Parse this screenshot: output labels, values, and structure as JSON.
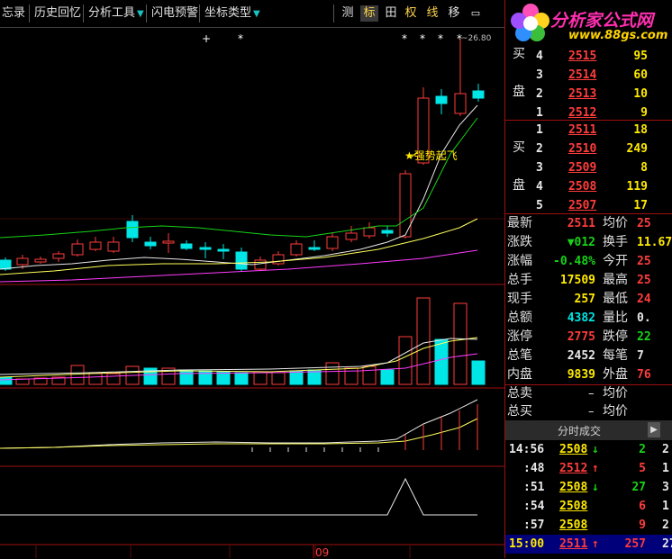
{
  "toolbar": {
    "items": [
      "忘录",
      "历史回忆",
      "分析工具",
      "闪电预警",
      "坐标类型"
    ],
    "buttons": [
      "测",
      "标",
      "田",
      "权",
      "线",
      "移"
    ],
    "active_button": "标"
  },
  "chart": {
    "annotation": "★强势起飞",
    "high_label": "26.80",
    "date_label": "09",
    "markers": [
      "+",
      "*",
      "*",
      "*",
      "*",
      "*"
    ]
  },
  "logo": {
    "main": "分析家公式网",
    "sub": "www.88gs.com"
  },
  "order_book": {
    "sell": [
      {
        "level": "5",
        "price": "2515",
        "vol": "42"
      },
      {
        "level": "4",
        "price": "2515",
        "vol": "95"
      },
      {
        "level": "3",
        "price": "2514",
        "vol": "60"
      },
      {
        "level": "2",
        "price": "2513",
        "vol": "10"
      },
      {
        "level": "1",
        "price": "2512",
        "vol": "9"
      }
    ],
    "sell_label": [
      "买",
      "盘"
    ],
    "buy": [
      {
        "level": "1",
        "price": "2511",
        "vol": "18"
      },
      {
        "level": "2",
        "price": "2510",
        "vol": "249"
      },
      {
        "level": "3",
        "price": "2509",
        "vol": "8"
      },
      {
        "level": "4",
        "price": "2508",
        "vol": "119"
      },
      {
        "level": "5",
        "price": "2507",
        "vol": "17"
      }
    ],
    "buy_label": [
      "买",
      "盘"
    ]
  },
  "quote": [
    {
      "l1": "最新",
      "v1": "2511",
      "l2": "均价",
      "v2": "25"
    },
    {
      "l1": "涨跌",
      "v1": "▼012",
      "l2": "换手",
      "v2": "11.67"
    },
    {
      "l1": "涨幅",
      "v1": "-0.48%",
      "l2": "今开",
      "v2": "25"
    },
    {
      "l1": "总手",
      "v1": "17509",
      "l2": "最高",
      "v2": "25"
    },
    {
      "l1": "现手",
      "v1": "257",
      "l2": "最低",
      "v2": "24"
    },
    {
      "l1": "总额",
      "v1": "4382",
      "l2": "量比",
      "v2": "0."
    },
    {
      "l1": "涨停",
      "v1": "2775",
      "l2": "跌停",
      "v2": "22"
    },
    {
      "l1": "总笔",
      "v1": "2452",
      "l2": "每笔",
      "v2": "7"
    },
    {
      "l1": "内盘",
      "v1": "9839",
      "l2": "外盘",
      "v2": "76"
    }
  ],
  "totals": [
    {
      "l1": "总卖",
      "v1": "–",
      "l2": "均价"
    },
    {
      "l1": "总买",
      "v1": "–",
      "l2": "均价"
    }
  ],
  "ticks_tab": "分时成交",
  "ticks": [
    {
      "time": "14:56",
      "price": "2508",
      "dir": "down",
      "vol": "2",
      "extra": "2"
    },
    {
      "time": ":48",
      "price": "2512",
      "dir": "up",
      "vol": "5",
      "extra": "1"
    },
    {
      "time": ":51",
      "price": "2508",
      "dir": "down",
      "vol": "27",
      "extra": "3"
    },
    {
      "time": ":54",
      "price": "2508",
      "dir": "none",
      "vol": "6",
      "extra": "1"
    },
    {
      "time": ":57",
      "price": "2508",
      "dir": "none",
      "vol": "9",
      "extra": "2"
    },
    {
      "time": "15:00",
      "price": "2511",
      "dir": "up",
      "vol": "257",
      "extra": "27"
    }
  ],
  "colors": {
    "up": "#ff3c3c",
    "down": "#00e5e5",
    "ma1": "#e8e8e8",
    "ma2": "#ffff5a",
    "ma3": "#17d417",
    "ma4": "#ff3cff",
    "grid": "#a01010"
  }
}
